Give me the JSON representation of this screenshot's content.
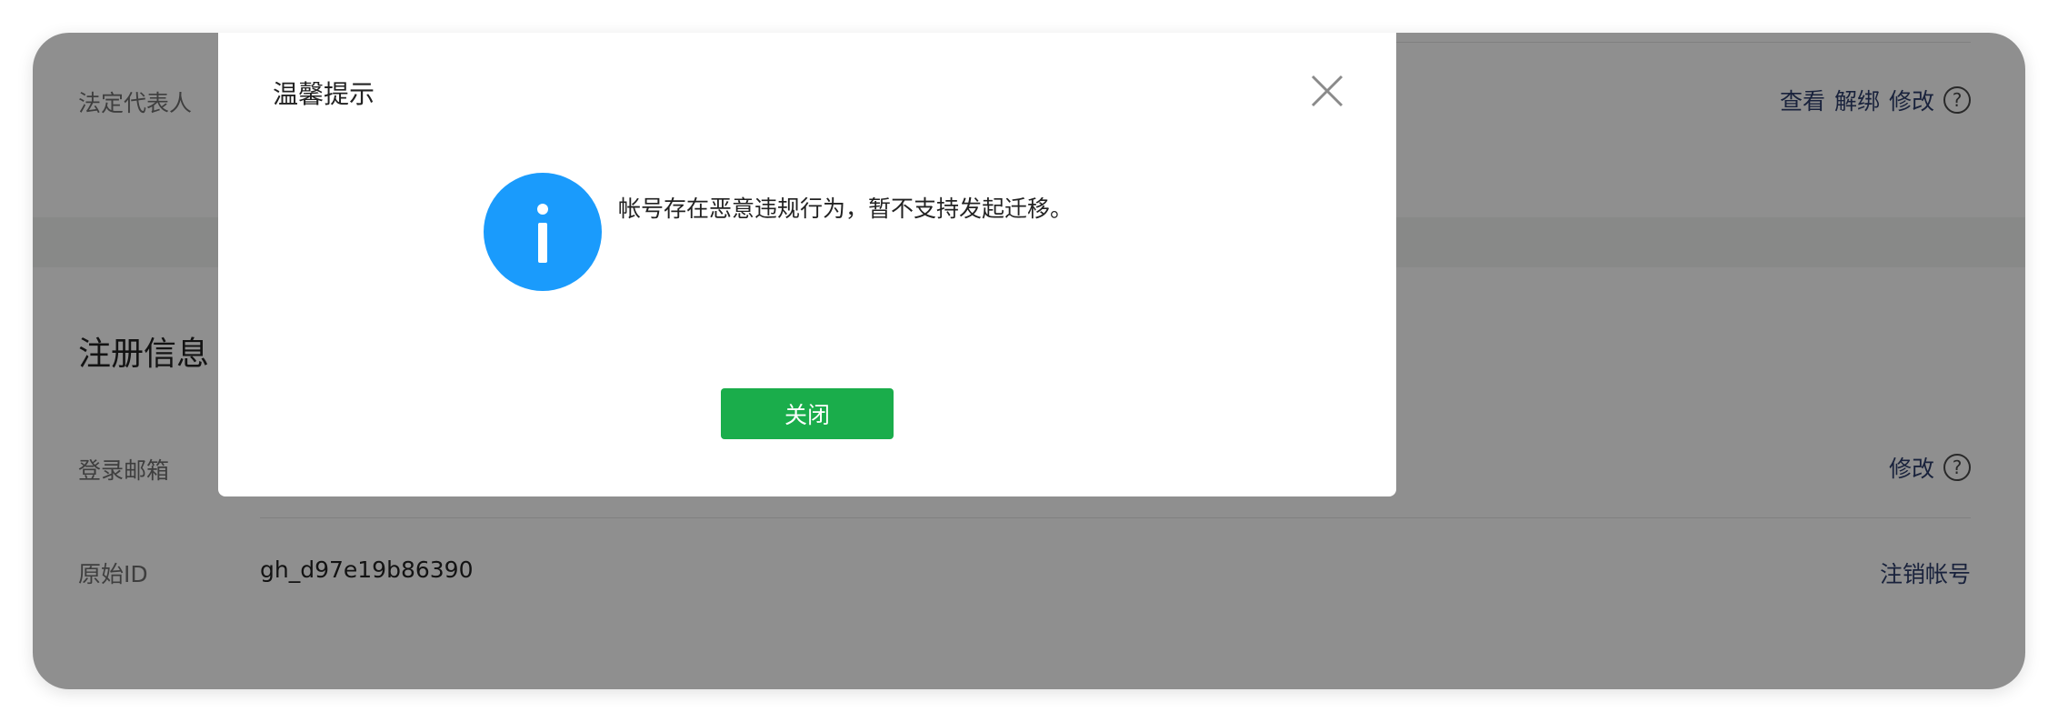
{
  "legal_rep": {
    "label": "法定代表人",
    "actions": [
      "查看",
      "解绑",
      "修改"
    ]
  },
  "registration": {
    "title": "注册信息",
    "email": {
      "label": "登录邮箱",
      "action": "修改"
    },
    "original_id": {
      "label": "原始ID",
      "value": "gh_d97e19b86390",
      "action": "注销帐号"
    }
  },
  "help_glyph": "?",
  "dialog": {
    "title": "温馨提示",
    "message": "帐号存在恶意违规行为，暂不支持发起迁移。",
    "icon": "info-icon",
    "close_label": "关闭"
  },
  "colors": {
    "accent_green": "#1aad4b",
    "info_blue": "#1a9bfc",
    "link": "#2d3e6b"
  }
}
